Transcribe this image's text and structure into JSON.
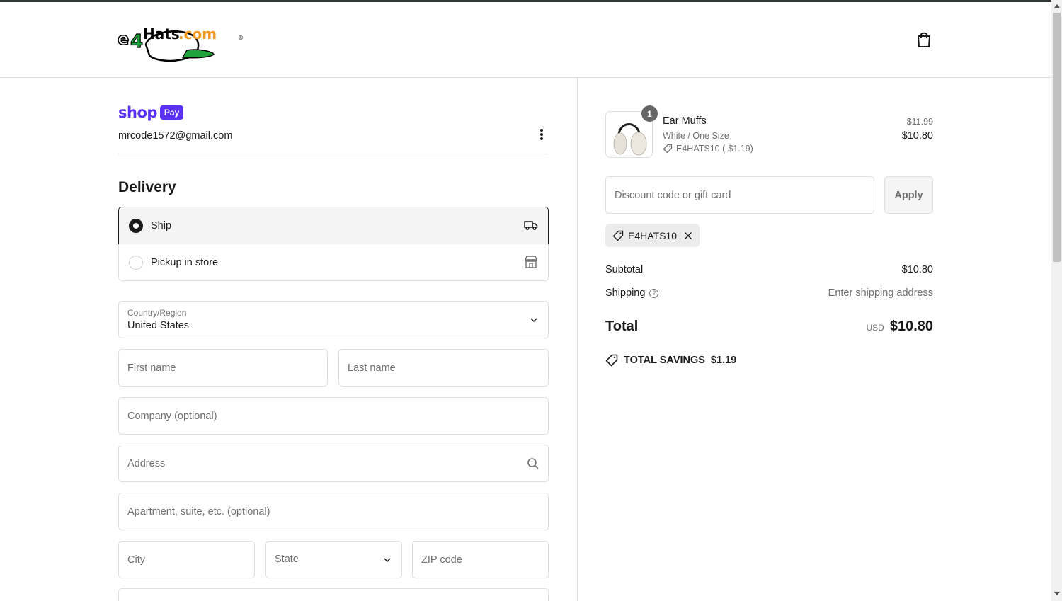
{
  "header": {
    "logo_text": "e4Hats.com",
    "cart_icon": "shopping-bag-icon"
  },
  "account": {
    "shoppay_brand": "shop",
    "shoppay_badge": "Pay",
    "email": "mrcode1572@gmail.com"
  },
  "delivery": {
    "title": "Delivery",
    "options": [
      {
        "label": "Ship",
        "selected": true,
        "icon": "truck-icon"
      },
      {
        "label": "Pickup in store",
        "selected": false,
        "icon": "store-icon"
      }
    ]
  },
  "form": {
    "country_label": "Country/Region",
    "country_value": "United States",
    "first_name_placeholder": "First name",
    "last_name_placeholder": "Last name",
    "company_placeholder": "Company (optional)",
    "address_placeholder": "Address",
    "apartment_placeholder": "Apartment, suite, etc. (optional)",
    "city_placeholder": "City",
    "state_placeholder": "State",
    "zip_placeholder": "ZIP code"
  },
  "order": {
    "item": {
      "quantity": "1",
      "name": "Ear Muffs",
      "variant": "White / One Size",
      "discount_line": "E4HATS10 (-$1.19)",
      "original_price": "$11.99",
      "price": "$10.80"
    },
    "discount_placeholder": "Discount code or gift card",
    "apply_label": "Apply",
    "applied_code": "E4HATS10",
    "subtotal_label": "Subtotal",
    "subtotal_value": "$10.80",
    "shipping_label": "Shipping",
    "shipping_value": "Enter shipping address",
    "total_label": "Total",
    "currency": "USD",
    "total_value": "$10.80",
    "savings_label": "TOTAL SAVINGS",
    "savings_value": "$1.19"
  },
  "colors": {
    "shoppay_purple": "#5a31f4",
    "logo_orange": "#f39a1e",
    "logo_green": "#1fa33a"
  }
}
